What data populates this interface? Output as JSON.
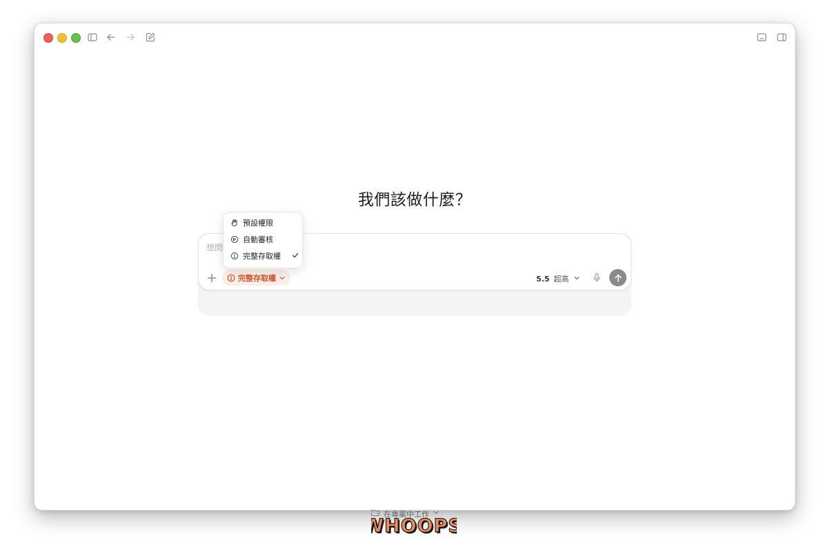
{
  "window": {
    "toolbar_icons": [
      "sidebar-toggle-icon",
      "back-arrow-icon",
      "forward-arrow-icon",
      "new-chat-icon",
      "terminal-panel-icon",
      "right-panel-icon"
    ]
  },
  "main": {
    "heading": "我們該做什麼？"
  },
  "composer": {
    "placeholder": "想問",
    "permission_selected": "完整存取權",
    "model_version": "5.5",
    "reasoning_level": "超高",
    "project_label": "在專案中工作"
  },
  "permission_menu": {
    "items": [
      {
        "label": "預設權限",
        "icon": "hand-icon"
      },
      {
        "label": "自動審核",
        "icon": "shield-check-icon"
      },
      {
        "label": "完整存取權",
        "icon": "alert-circle-icon",
        "checked": true
      }
    ]
  },
  "watermark": {
    "text": "WHOOPS"
  },
  "colors": {
    "accent": "#d0582a",
    "traffic_red": "#ec5f57",
    "traffic_yellow": "#f4bf2f",
    "traffic_green": "#5fc443"
  }
}
